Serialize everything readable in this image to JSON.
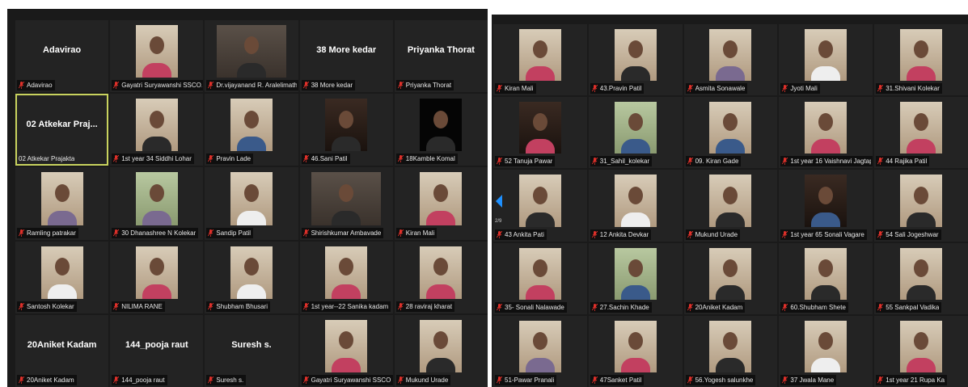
{
  "left_grid": {
    "tiles": [
      {
        "label": "Adavirao",
        "big_name": "Adavirao",
        "video": false
      },
      {
        "label": "Gayatri Suryawanshi SSCO...",
        "video": true,
        "style": "",
        "body": ""
      },
      {
        "label": "Dr.vijayanand R. Aralelimath",
        "video": true,
        "style": "wide",
        "body": "b5"
      },
      {
        "label": "38 More kedar",
        "big_name": "38 More kedar",
        "video": false
      },
      {
        "label": "Priyanka Thorat",
        "big_name": "Priyanka Thorat",
        "video": false
      },
      {
        "label": "02 Atkekar Prajakta",
        "big_name": "02 Atkekar Praj...",
        "video": false,
        "active": true,
        "muted": false
      },
      {
        "label": "1st year 34 Siddhi Lohar",
        "video": true,
        "style": "",
        "body": "b5"
      },
      {
        "label": "Pravin Lade",
        "video": true,
        "style": "",
        "body": "b2"
      },
      {
        "label": "46.Sani Patil",
        "video": true,
        "style": "dark",
        "body": "b5"
      },
      {
        "label": "18Kamble Komal",
        "video": true,
        "style": "black",
        "body": "b5"
      },
      {
        "label": "Ramling patrakar",
        "video": true,
        "style": "",
        "body": "b4"
      },
      {
        "label": "30 Dhanashree N Kolekar",
        "video": true,
        "style": "green",
        "body": "b4"
      },
      {
        "label": "Sandip Patil",
        "video": true,
        "style": "",
        "body": "b3"
      },
      {
        "label": "Shirishkumar Ambavade",
        "video": true,
        "style": "wide",
        "body": "b5"
      },
      {
        "label": "Kiran Mali",
        "video": true,
        "style": "",
        "body": ""
      },
      {
        "label": "Santosh Kolekar",
        "video": true,
        "style": "",
        "body": "b3"
      },
      {
        "label": "NILIMA RANE",
        "video": true,
        "style": "",
        "body": ""
      },
      {
        "label": "Shubham Bhusari",
        "video": true,
        "style": "",
        "body": "b3"
      },
      {
        "label": "1st year--22 Sanika kadam",
        "video": true,
        "style": "",
        "body": ""
      },
      {
        "label": "28 raviraj kharat",
        "video": true,
        "style": "",
        "body": ""
      },
      {
        "label": "20Aniket Kadam",
        "big_name": "20Aniket Kadam",
        "video": false
      },
      {
        "label": "144_pooja raut",
        "big_name": "144_pooja raut",
        "video": false
      },
      {
        "label": "Suresh s.",
        "big_name": "Suresh s.",
        "video": false
      },
      {
        "label": "Gayatri Suryawanshi SSCO...",
        "video": true,
        "style": "",
        "body": ""
      },
      {
        "label": "Mukund Urade",
        "video": true,
        "style": "",
        "body": "b5"
      }
    ]
  },
  "right_grid": {
    "tiles": [
      {
        "label": "Kiran Mali",
        "video": true,
        "style": "",
        "body": ""
      },
      {
        "label": "43.Pravin Patil",
        "video": true,
        "style": "",
        "body": "b5"
      },
      {
        "label": "Asmita Sonawale",
        "video": true,
        "style": "",
        "body": "b4"
      },
      {
        "label": "Jyoti Mali",
        "video": true,
        "style": "",
        "body": "b3"
      },
      {
        "label": "31.Shivani Kolekar",
        "video": true,
        "style": "",
        "body": ""
      },
      {
        "label": "52 Tanuja Pawar",
        "video": true,
        "style": "dark",
        "body": ""
      },
      {
        "label": "31_Sahil_kolekar",
        "video": true,
        "style": "green",
        "body": "b2"
      },
      {
        "label": "09. Kiran Gade",
        "video": true,
        "style": "",
        "body": "b2"
      },
      {
        "label": "1st year 16 Vaishnavi Jagtap",
        "video": true,
        "style": "",
        "body": ""
      },
      {
        "label": "44 Rajika Patil",
        "video": true,
        "style": "",
        "body": ""
      },
      {
        "label": "43 Ankita Pati",
        "video": true,
        "style": "",
        "body": "b5"
      },
      {
        "label": "12 Ankita Devkar",
        "video": true,
        "style": "",
        "body": "b3"
      },
      {
        "label": "Mukund Urade",
        "video": true,
        "style": "",
        "body": "b5"
      },
      {
        "label": "1st year 65 Sonali Vagare",
        "video": true,
        "style": "dark",
        "body": "b2"
      },
      {
        "label": "54 Sali Jogeshwar",
        "video": true,
        "style": "",
        "body": "b5"
      },
      {
        "label": "35- Sonali Nalawade",
        "video": true,
        "style": "",
        "body": ""
      },
      {
        "label": "27.Sachin Khade",
        "video": true,
        "style": "green",
        "body": "b2"
      },
      {
        "label": "20Aniket Kadam",
        "video": true,
        "style": "",
        "body": "b5"
      },
      {
        "label": "60.Shubham Shete",
        "video": true,
        "style": "",
        "body": "b5"
      },
      {
        "label": "55 Sankpal Vadika",
        "video": true,
        "style": "",
        "body": "b5"
      },
      {
        "label": "51-Pawar Pranali",
        "video": true,
        "style": "",
        "body": "b4"
      },
      {
        "label": "47Sanket Patil",
        "video": true,
        "style": "",
        "body": ""
      },
      {
        "label": "56.Yogesh salunkhe",
        "video": true,
        "style": "",
        "body": "b5"
      },
      {
        "label": "37 Jwala Mane",
        "video": true,
        "style": "",
        "body": "b3"
      },
      {
        "label": "1st year 21 Rupa Ka",
        "video": true,
        "style": "",
        "body": ""
      }
    ]
  },
  "pagination": {
    "indicator": "2/9"
  },
  "icons": {
    "mic": "muted-mic-icon",
    "nav": "chevron-left-icon"
  },
  "colors": {
    "mic_muted": "#e0302a",
    "active_border": "#c8d25e",
    "nav_arrow": "#1e90ff"
  }
}
